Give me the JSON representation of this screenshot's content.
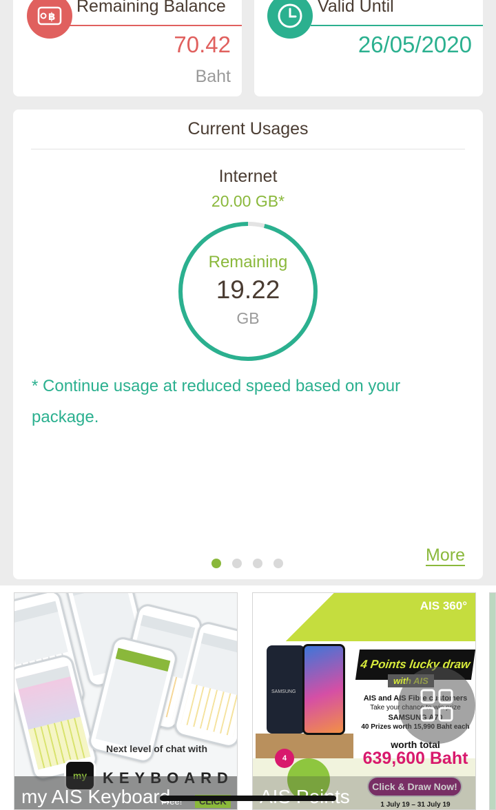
{
  "balance": {
    "title": "Remaining Balance",
    "value": "70.42",
    "unit": "Baht",
    "icon": "baht-wallet-icon",
    "color": "#e0605e"
  },
  "validity": {
    "title": "Valid Until",
    "value": "26/05/2020",
    "icon": "clock-icon",
    "color": "#2bb08f"
  },
  "usage": {
    "title": "Current Usages",
    "category": "Internet",
    "quota": "20.00 GB*",
    "remaining_label": "Remaining",
    "remaining_value": "19.22",
    "remaining_unit": "GB",
    "remaining_fraction": 0.961,
    "note": "* Continue usage at reduced speed based on your package.",
    "pager": {
      "total": 4,
      "active": 0
    },
    "more_label": "More"
  },
  "banners": [
    {
      "label": "my AIS Keyboard",
      "caption": "Next level of chat with",
      "logo_text": "my",
      "word": "KEYBOARD",
      "free_text": "Free!",
      "cta": "CLICK"
    },
    {
      "label": "AIS Points",
      "logo": "AIS 360°",
      "tag": "4 Points lucky draw",
      "sub_tag": "with AIS",
      "lines": [
        "AIS and AIS Fibre customers",
        "Take your chance to win prize",
        "SAMSUNG A70",
        "40 Prizes worth 15,990 Baht each"
      ],
      "total_label": "worth total",
      "total_value": "639,600 Baht",
      "cta": "Click & Draw Now!",
      "dates": "1 July 19 – 31 July 19",
      "badge": "4",
      "phone_brand": "SAMSUNG"
    }
  ],
  "colors": {
    "green": "#8ab83b",
    "teal": "#2bb08f",
    "red": "#e0605e",
    "text": "#4a3c32"
  }
}
